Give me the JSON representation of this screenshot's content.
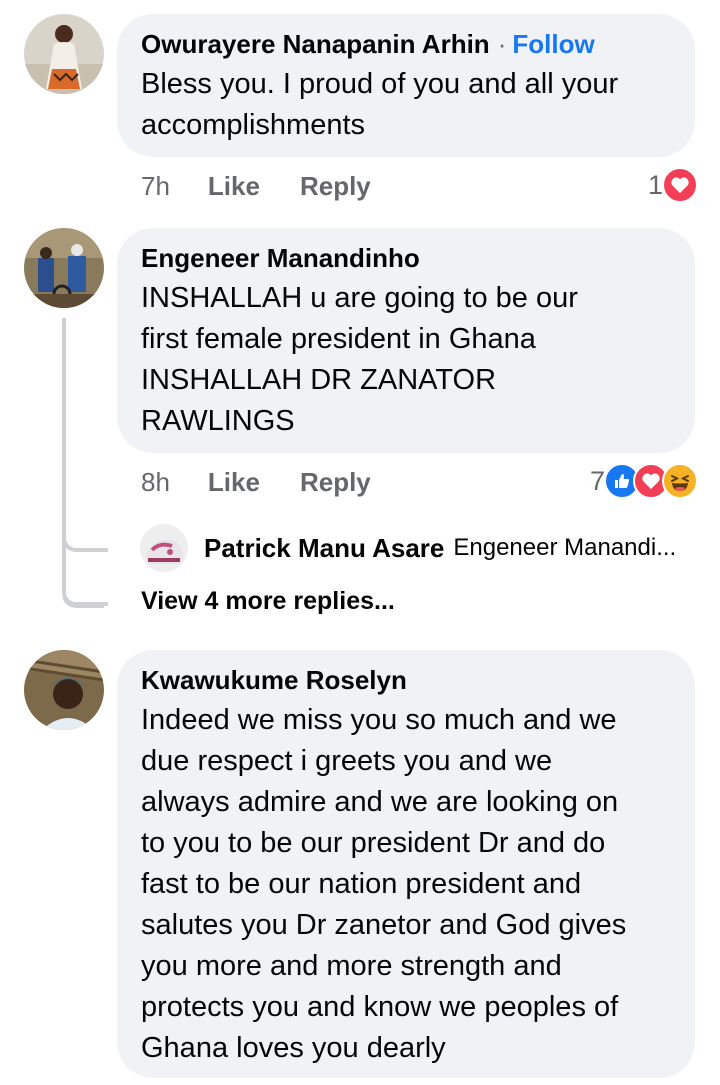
{
  "comments": [
    {
      "author": "Owurayere Nanapanin Arhin",
      "separator": "·",
      "follow_label": "Follow",
      "text": "Bless you. I  proud of you and all your\naccomplishments",
      "time": "7h",
      "like_label": "Like",
      "reply_label": "Reply",
      "reaction_count": "1",
      "reactions": [
        "love-icon"
      ]
    },
    {
      "author": "Engeneer Manandinho",
      "text": "INSHALLAH u are going to be our\nfirst female president in Ghana\nINSHALLAH DR ZANATOR\nRAWLINGS",
      "time": "8h",
      "like_label": "Like",
      "reply_label": "Reply",
      "reaction_count": "7",
      "reactions": [
        "like-icon",
        "love-icon",
        "haha-icon"
      ],
      "reply_preview": {
        "author": "Patrick Manu Asare",
        "snippet": "Engeneer Manandi..."
      },
      "view_more_label": "View 4 more replies..."
    },
    {
      "author": "Kwawukume Roselyn",
      "text": "Indeed we miss you so much and we\ndue respect i greets you and  we\nalways admire and we are looking on\nto you to be our president Dr and do\nfast to be our nation president and\nsalutes you Dr zanetor and God gives\nyou more and more strength and\nprotects you and know we peoples of\nGhana loves you dearly"
    }
  ],
  "colors": {
    "bubble": "#f0f2f5",
    "follow": "#1877f2",
    "muted": "#65676b",
    "like": "#1877f2",
    "love": "#f33e58",
    "haha": "#f7b125"
  }
}
